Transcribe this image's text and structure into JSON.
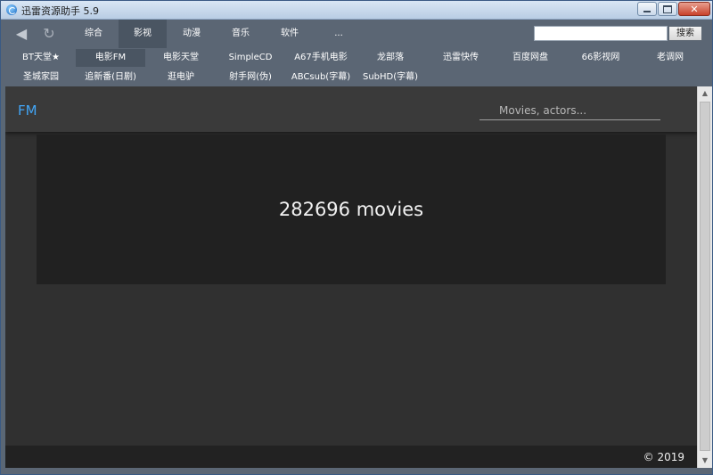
{
  "window": {
    "title": "迅雷资源助手 5.9",
    "close_glyph": "✕"
  },
  "toolbar": {
    "back_icon": "◀",
    "refresh_icon": "↻",
    "tabs": [
      "综合",
      "影视",
      "动漫",
      "音乐",
      "软件",
      "..."
    ],
    "active_tab": "影视",
    "search_value": "",
    "search_button": "搜索"
  },
  "sites": {
    "row1": [
      "BT天堂★",
      "电影FM",
      "电影天堂",
      "SimpleCD",
      "A67手机电影",
      "龙部落",
      "迅雷快传",
      "百度网盘",
      "66影视网",
      "老调网"
    ],
    "row2": [
      "圣城家园",
      "追新番(日剧)",
      "逛电驴",
      "射手网(伪)",
      "ABCsub(字幕)",
      "SubHD(字幕)"
    ],
    "active": "电影FM"
  },
  "web": {
    "logo": "FM",
    "search_placeholder": "Movies, actors...",
    "movie_count": "282696 movies",
    "copyright": "© 2019"
  },
  "scrollbar": {
    "up_icon": "▲",
    "down_icon": "▼"
  },
  "colors": {
    "accent": "#42a5f5",
    "toolbar_bg": "#5b6674",
    "active_tab_bg": "#4a5562",
    "content_bg": "#303030",
    "hero_bg": "#212121"
  }
}
